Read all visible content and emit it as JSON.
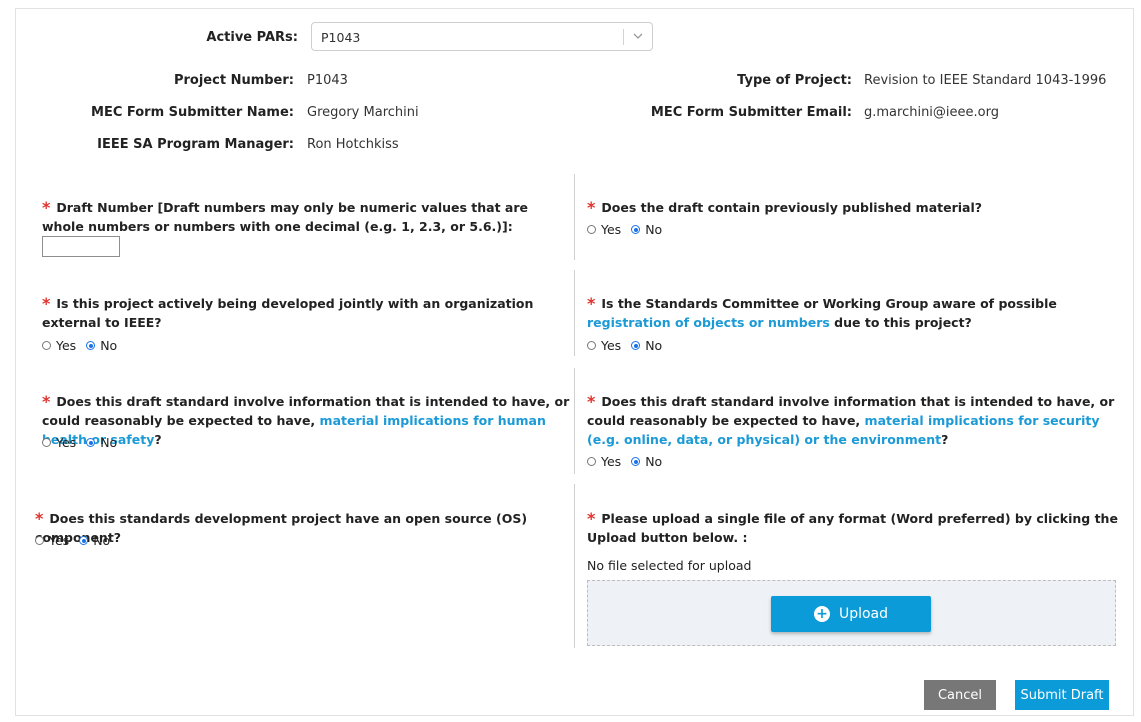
{
  "active_pars": {
    "label": "Active PARs:",
    "selected": "P1043"
  },
  "info": {
    "project_number": {
      "label": "Project Number:",
      "value": "P1043"
    },
    "type_of_project": {
      "label": "Type of Project:",
      "value": "Revision to IEEE Standard 1043-1996"
    },
    "submitter_name": {
      "label": "MEC Form Submitter Name:",
      "value": "Gregory Marchini"
    },
    "submitter_email": {
      "label": "MEC Form Submitter Email:",
      "value": "g.marchini@ieee.org"
    },
    "program_manager": {
      "label": "IEEE SA Program Manager:",
      "value": "Ron Hotchkiss"
    }
  },
  "required_marker": "*",
  "radio_labels": {
    "yes": "Yes",
    "no": "No"
  },
  "questions": {
    "draft_number": {
      "text": "Draft Number [Draft numbers may only be numeric values that are whole numbers or numbers with one decimal (e.g. 1, 2.3, or 5.6.)]:",
      "value": ""
    },
    "published_material": {
      "text": "Does the draft contain previously published material?",
      "selected": "No"
    },
    "joint_development": {
      "text": "Is this project actively being developed jointly with an organization external to IEEE?",
      "selected": "No"
    },
    "registration": {
      "text_before": "Is the Standards Committee or Working Group aware of possible ",
      "link": "registration of objects or numbers",
      "text_after": " due to this project?",
      "selected": "No"
    },
    "health_safety": {
      "text_before": "Does this draft standard involve information that is intended to have, or could reasonably be expected to have, ",
      "link": "material implications for human health or safety",
      "text_after": "?",
      "selected": "No"
    },
    "security_environment": {
      "text_before": "Does this draft standard involve information that is intended to have, or could reasonably be expected to have, ",
      "link": "material implications for security (e.g. online, data, or physical) or the environment",
      "text_after": "?",
      "selected": "No"
    },
    "open_source": {
      "text": "Does this standards development project have an open source (OS) component?",
      "selected": "No"
    },
    "upload": {
      "text": "Please upload a single file of any format (Word preferred) by clicking the Upload button below. :",
      "status": "No file selected for upload",
      "button_label": "Upload"
    }
  },
  "actions": {
    "cancel_label": "Cancel",
    "submit_label": "Submit Draft"
  },
  "colors": {
    "accent": "#0a9bd8",
    "link": "#1b9ad6",
    "required": "#e0332f",
    "cancel": "#777777"
  }
}
